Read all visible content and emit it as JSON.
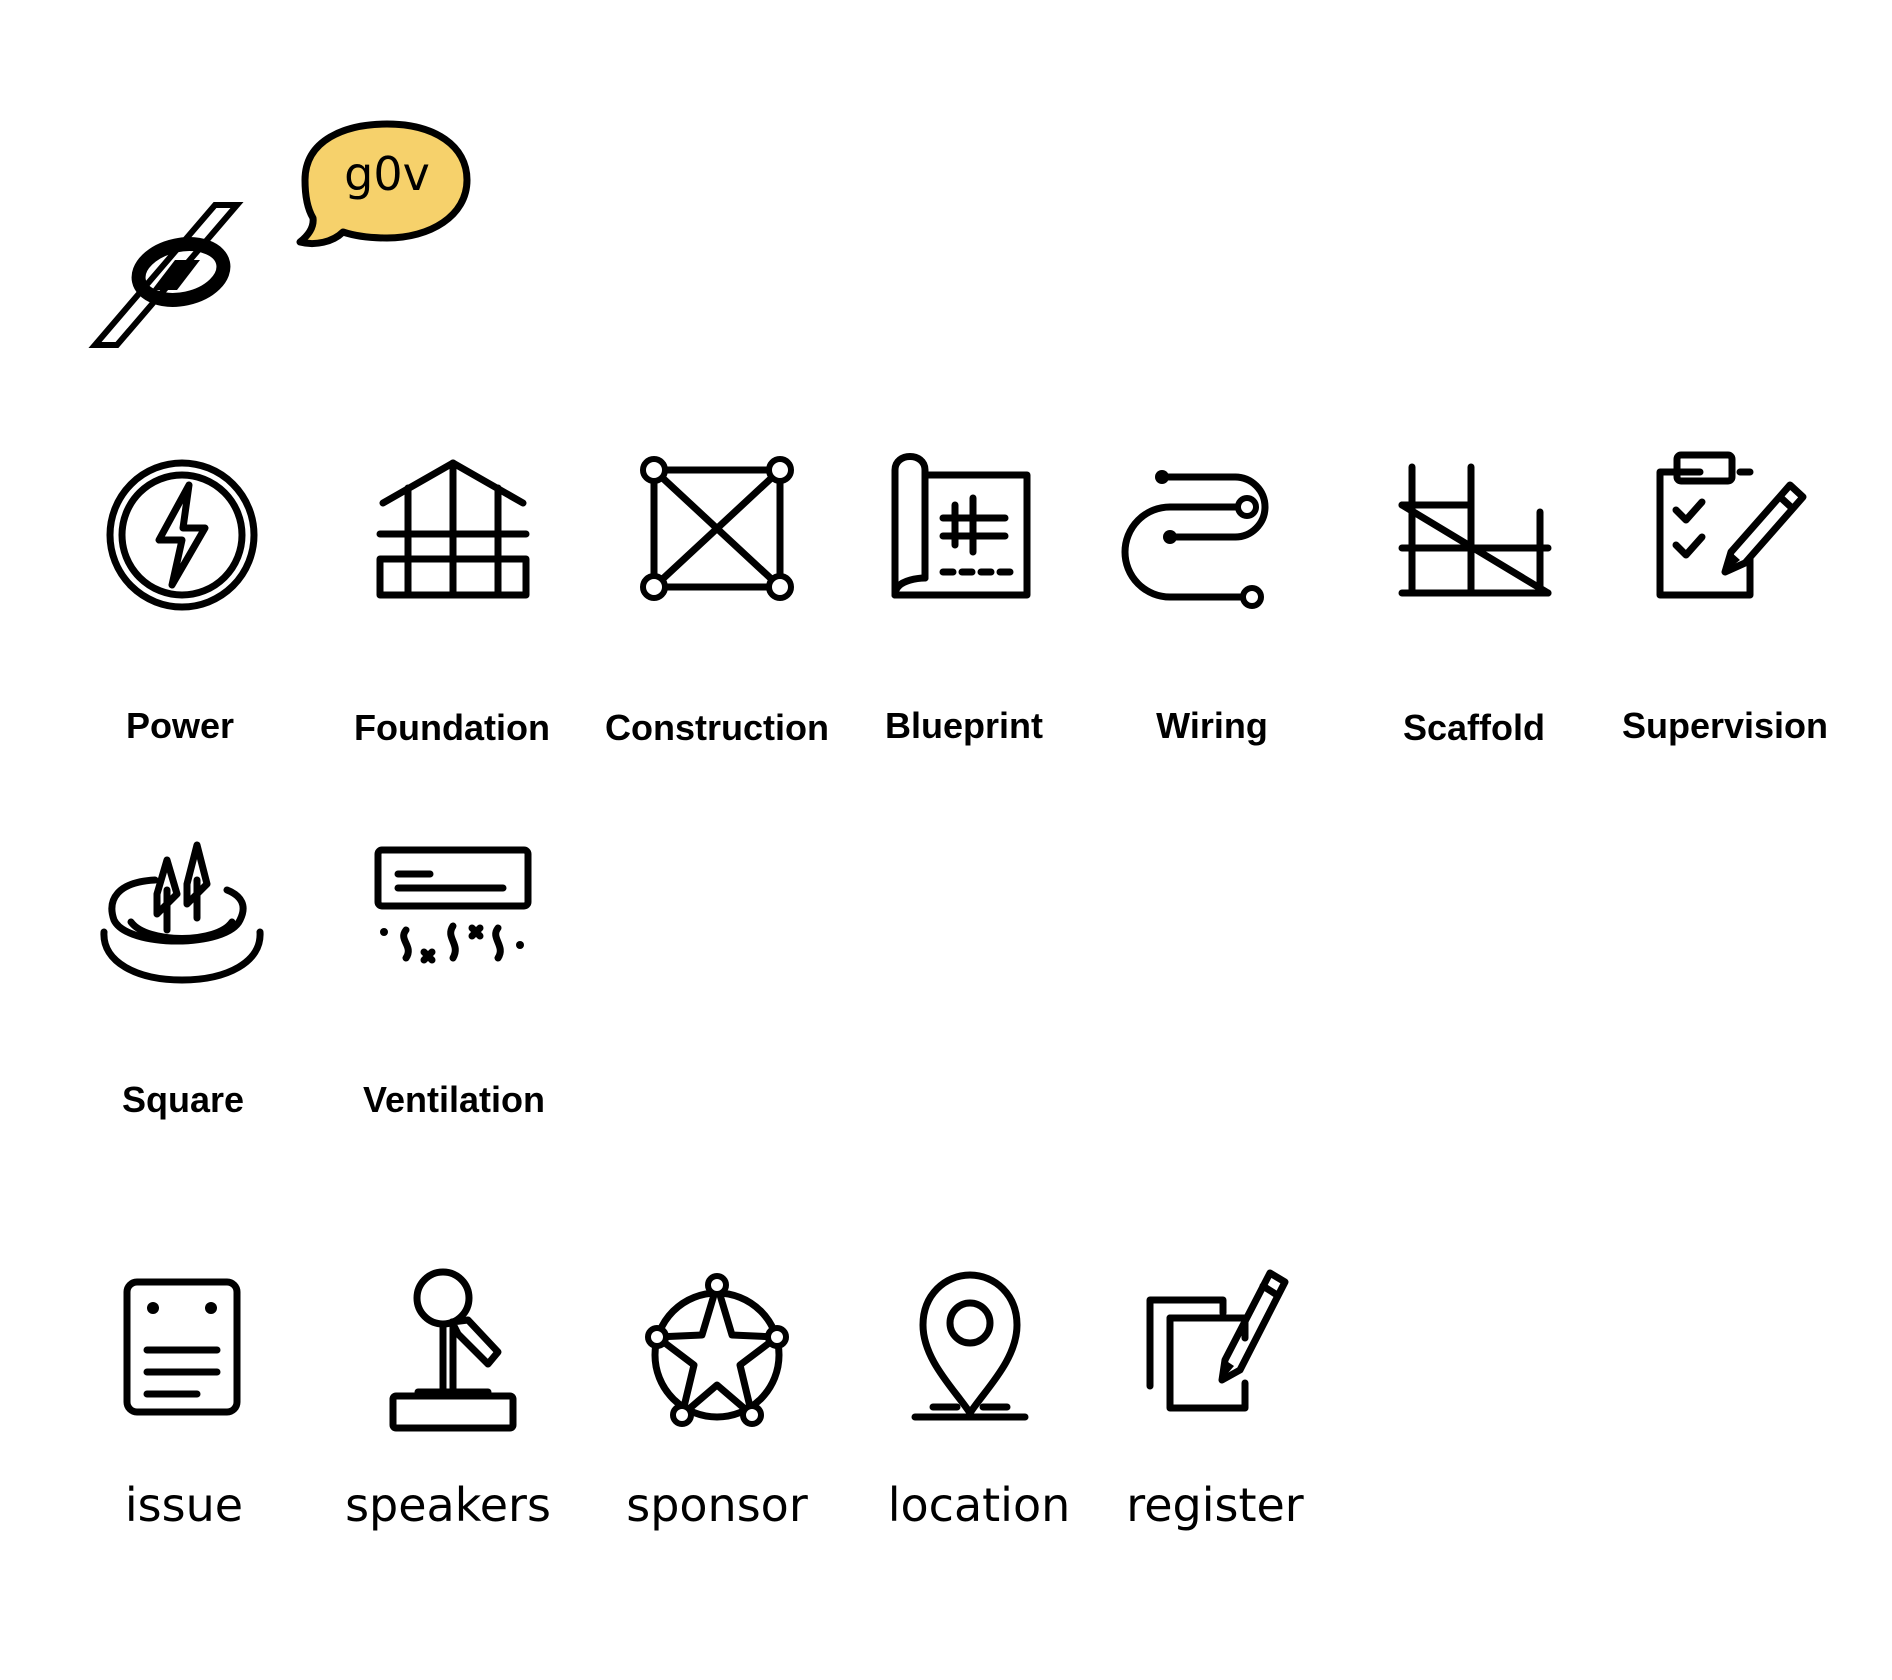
{
  "brand": {
    "logo_text": "g0v",
    "bubble_color": "#f6d16b"
  },
  "row1": [
    {
      "label": "Power",
      "icon": "power-icon"
    },
    {
      "label": "Foundation",
      "icon": "foundation-icon"
    },
    {
      "label": "Construction",
      "icon": "construction-icon"
    },
    {
      "label": "Blueprint",
      "icon": "blueprint-icon"
    },
    {
      "label": "Wiring",
      "icon": "wiring-icon"
    },
    {
      "label": "Scaffold",
      "icon": "scaffold-icon"
    },
    {
      "label": "Supervision",
      "icon": "supervision-icon"
    }
  ],
  "row2": [
    {
      "label": "Square",
      "icon": "square-pond-icon"
    },
    {
      "label": "Ventilation",
      "icon": "ventilation-icon"
    }
  ],
  "row3": [
    {
      "label": "issue",
      "icon": "document-icon"
    },
    {
      "label": "speakers",
      "icon": "microphone-icon"
    },
    {
      "label": "sponsor",
      "icon": "star-network-icon"
    },
    {
      "label": "location",
      "icon": "map-pin-icon"
    },
    {
      "label": "register",
      "icon": "edit-icon"
    }
  ]
}
